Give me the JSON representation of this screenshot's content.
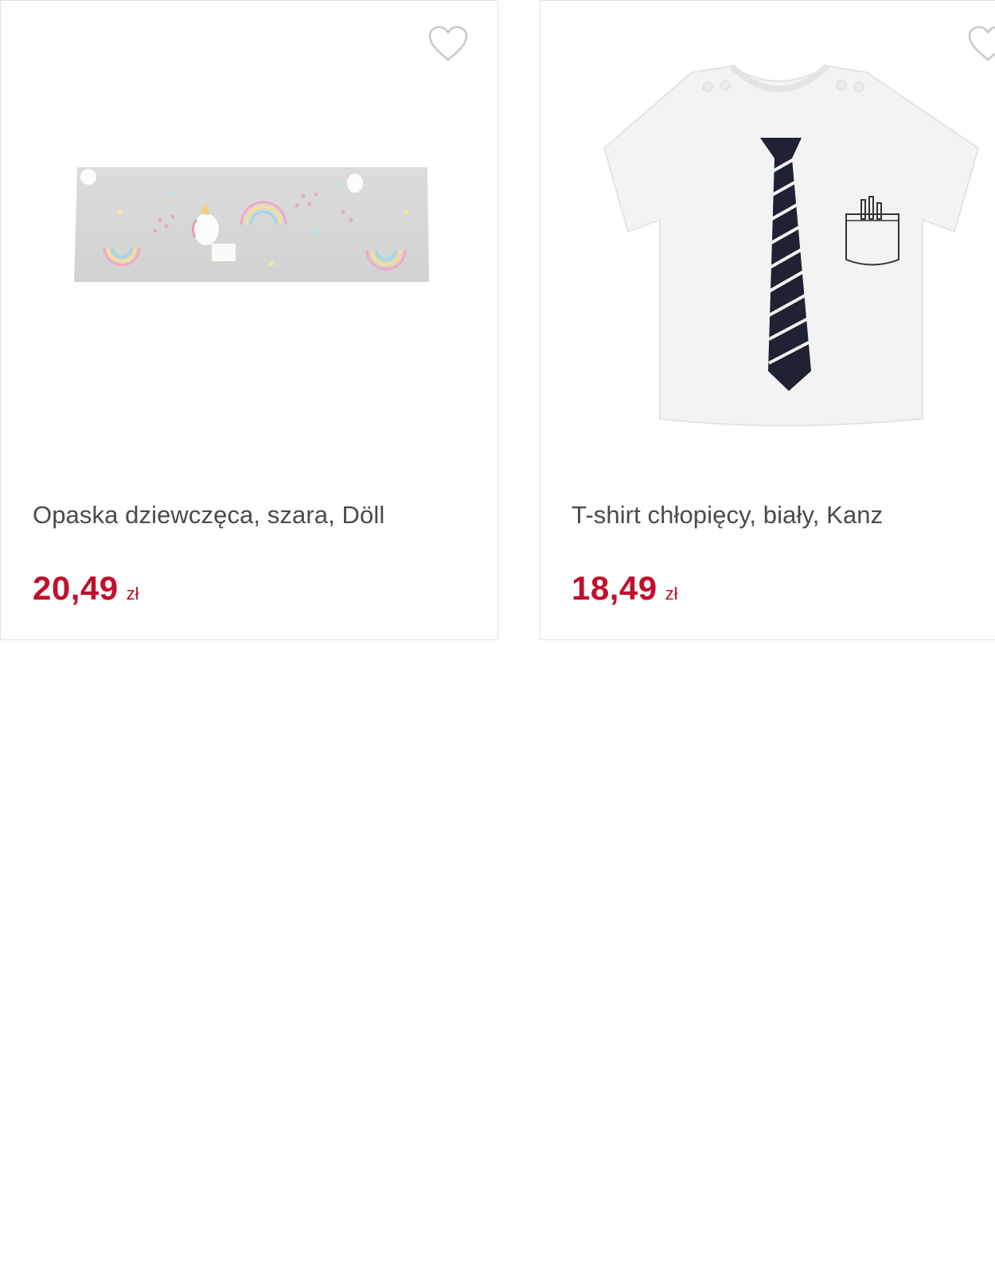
{
  "products": [
    {
      "name": "Opaska dziewczęca, szara, Döll",
      "price": "20,49",
      "currency": "zł",
      "image_icon": "headband-image",
      "favorite_icon": "heart-outline-icon"
    },
    {
      "name": "T-shirt chłopięcy, biały, Kanz",
      "price": "18,49",
      "currency": "zł",
      "image_icon": "tshirt-with-tie-image",
      "favorite_icon": "heart-outline-icon"
    }
  ],
  "colors": {
    "price": "#c0102b",
    "text": "#4a4a4a",
    "border": "#e2e2e2"
  }
}
